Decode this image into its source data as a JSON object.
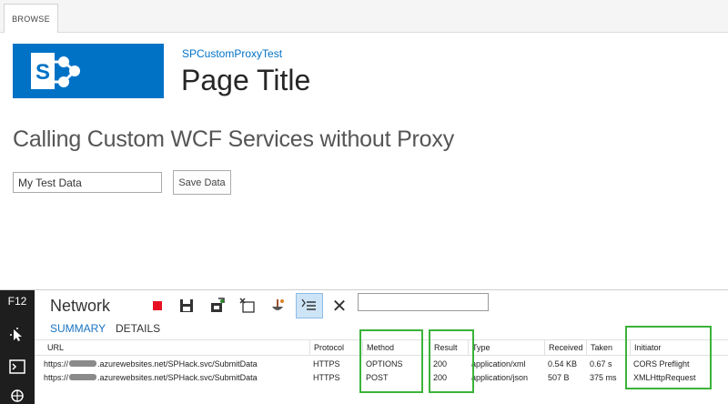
{
  "ribbon": {
    "browse_tab": "BROWSE"
  },
  "site": {
    "name": "SPCustomProxyTest",
    "page_title": "Page Title"
  },
  "main": {
    "heading": "Calling Custom WCF Services without Proxy",
    "input_value": "My Test Data",
    "save_button": "Save Data"
  },
  "devtools": {
    "f12_label": "F12",
    "tool_label": "Network",
    "tabs": {
      "summary": "SUMMARY",
      "details": "DETAILS"
    },
    "filter_value": "",
    "columns": [
      "URL",
      "Protocol",
      "Method",
      "Result",
      "Type",
      "Received",
      "Taken",
      "Initiator"
    ],
    "rows": [
      {
        "url_prefix": "https://",
        "url_suffix": ".azurewebsites.net/SPHack.svc/SubmitData",
        "protocol": "HTTPS",
        "method": "OPTIONS",
        "result": "200",
        "type": "application/xml",
        "received": "0.54 KB",
        "taken": "0.67 s",
        "initiator": "CORS Preflight"
      },
      {
        "url_prefix": "https://",
        "url_suffix": ".azurewebsites.net/SPHack.svc/SubmitData",
        "protocol": "HTTPS",
        "method": "POST",
        "result": "200",
        "type": "application/json",
        "received": "507 B",
        "taken": "375 ms",
        "initiator": "XMLHttpRequest"
      }
    ],
    "icons": {
      "record": "stop-recording-icon",
      "save": "save-icon",
      "import": "import-icon",
      "clear": "clear-session-icon",
      "clear_cache": "clear-cache-icon",
      "always_refresh": "always-refresh-icon",
      "close": "close-icon",
      "select_element": "select-element-icon",
      "console": "console-icon",
      "debugger": "debugger-icon"
    },
    "highlight_color": "#3bb33a"
  },
  "colors": {
    "brand": "#0072c6",
    "f12_bar": "#1e1e1e",
    "record": "#e81123"
  }
}
